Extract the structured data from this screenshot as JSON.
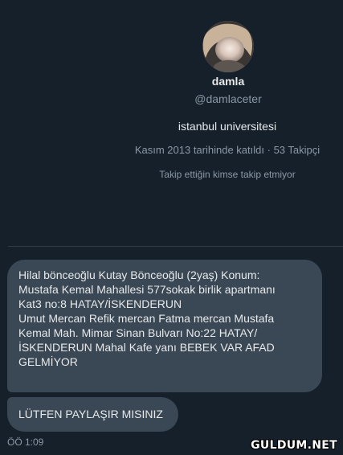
{
  "profile": {
    "name": "damla",
    "handle": "@damlaceter",
    "bio": "istanbul universitesi",
    "joined": "Kasım 2013 tarihinde katıldı",
    "separator": "·",
    "followers": "53 Takipçi",
    "follow_note": "Takip ettiğin kimse takip etmiyor"
  },
  "conversation": {
    "messages": [
      {
        "lines": [
          "Hilal bönceoğlu Kutay Bönceoğlu (2yaş) Konum:",
          "Mustafa Kemal Mahallesi 577sokak birlik apartmanı",
          "Kat3 no:8 HATAY/İSKENDERUN",
          "Umut Mercan Refik mercan Fatma mercan  Mustafa",
          "Kemal Mah. Mimar Sinan Bulvarı No:22 HATAY/",
          "İSKENDERUN  Mahal Kafe yanı BEBEK VAR AFAD",
          "GELMİYOR"
        ]
      },
      {
        "text": "LÜTFEN PAYLAŞIR MISINIZ"
      }
    ],
    "timestamp": "ÖÖ 1:09"
  },
  "watermark": "GULDUM.NET",
  "colors": {
    "background": "#15202b",
    "bubble": "#3a4754",
    "secondary_text": "#8b98a5",
    "primary_text": "#e7e9ea"
  }
}
